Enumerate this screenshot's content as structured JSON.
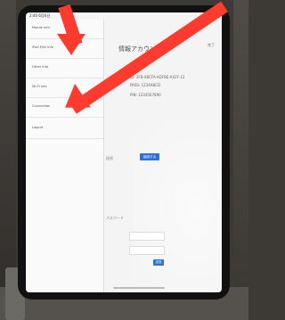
{
  "status": {
    "time": "2:40 6月6日",
    "right": "63%"
  },
  "sidebar": {
    "items": [
      {
        "label": "Mobile Info"
      },
      {
        "label": "iPad Mini Info"
      },
      {
        "label": "Other Info"
      },
      {
        "label": "Wi-Fi Info"
      },
      {
        "label": "Connection"
      },
      {
        "label": "Logout"
      }
    ]
  },
  "main": {
    "title": "情報アカウント",
    "header_right": "完了",
    "rows": [
      {
        "text": "ID: 3FB-XBCFA-ADFBE-AX2F-12"
      },
      {
        "text": "PASS: 1234ABCD"
      },
      {
        "text": "PIN: 1234567890"
      }
    ],
    "connect_label": "接続",
    "connect_button": "接続する",
    "section_label": "パスワード",
    "submit_button": "送信"
  },
  "annotations": {
    "arrow_color": "#ff3b30"
  }
}
